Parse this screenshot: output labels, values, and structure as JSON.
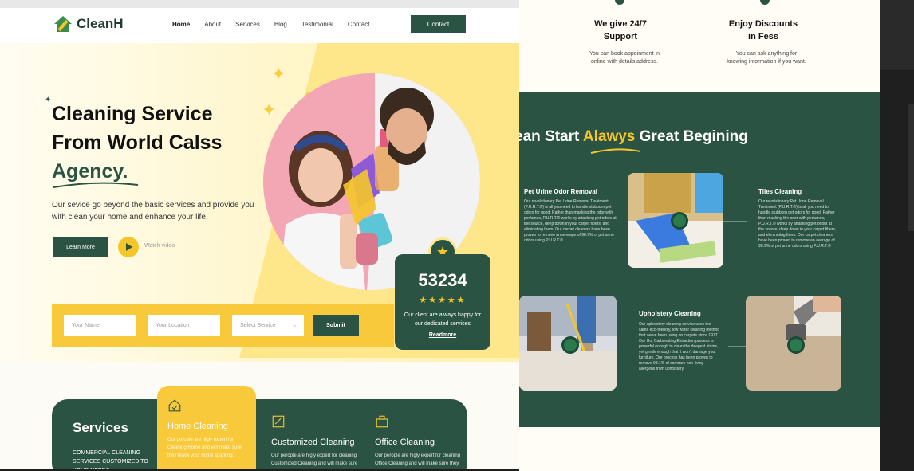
{
  "left": {
    "brand": "CleanH",
    "nav": [
      "Home",
      "About",
      "Services",
      "Blog",
      "Testimonial",
      "Contact"
    ],
    "nav_button": "Contact",
    "hero": {
      "line1": "Cleaning Service",
      "line2": "From World Calss",
      "line3": "Agency.",
      "desc": "Our sevice go beyond the basic services and provide you with clean your home and enhance your life.",
      "learn_more": "Learn More",
      "watch_video": "Watch video"
    },
    "stat": {
      "number": "53234",
      "stars": "★★★★★",
      "desc": "Our client are always happy for our dedicated services",
      "link": "Readmore"
    },
    "form": {
      "name_ph": "Your Name",
      "location_ph": "Your Location",
      "service_ph": "Select Service",
      "submit": "Submit"
    },
    "services": {
      "title": "Services",
      "desc": "COMMERCIAL CLEANING SERVICES CUSTOMIZED TO YOUR NEEDS",
      "items": [
        {
          "title": "Home Cleaning",
          "desc": "Our perople are higly expert for Cleaning Home and will make sure they leave your home sparking."
        },
        {
          "title": "Customized Cleaning",
          "desc": "Our perople are higly expert for cleaning Customized Cleaning and will make sure they leave"
        },
        {
          "title": "Office Cleaning",
          "desc": "Our perople are higly expert for cleaning Office Cleaning and will make sure they leave"
        }
      ]
    }
  },
  "right": {
    "features": [
      {
        "title": "We give 24/7 Support",
        "desc": "You can book appoinment in online with details address."
      },
      {
        "title": "Enjoy Discounts in Fess",
        "desc": "You can ask anything for knowing information if you want."
      }
    ],
    "heading_pre": "ean Start ",
    "heading_highlight": "Alawys",
    "heading_post": " Great Begining",
    "process": [
      {
        "title": "Pet Urine Odor Removal",
        "desc": "Our revolutionary Pet Urine Removal Treatment (P.U.R.T.®) is all you need to handle stubborn pet odors for good. Rather than masking the odor with perfumes, P.U.R.T.® works by attacking pet odors at the source, deep down in your carpet fibers, and eliminating them. Our carpet cleaners have been proven to remove an average of 98.9% of pet urine odors using P.U.R.T.®"
      },
      {
        "title": "Tiles Cleaning",
        "desc": "Our revolutionary Pet Urine Removal Treatment (P.U.R.T.®) is all you need to handle stubborn pet odors for good. Rather than masking the odor with perfumes, P.U.R.T.® works by attacking pet odors at the source, deep down in your carpet fibers, and eliminating them. Our carpet cleaners have been proven to remove an average of 98.9% of pet urine odors using P.U.R.T.®"
      },
      {
        "title": "Upholstery Cleaning",
        "desc": "Our upholstery cleaning service uses the same eco-friendly, low water cleaning method that we've been using on carpets since 1977. Our Hot Carbonating Extraction process is powerful enough to clean the deepest stains, yet gentle enough that it won't damage your furniture. Our process has been proven to remove 98.1% of common non-living allergens from upholstery."
      }
    ]
  },
  "colors": {
    "brand_green": "#2b5343",
    "accent_yellow": "#f8c93a"
  }
}
